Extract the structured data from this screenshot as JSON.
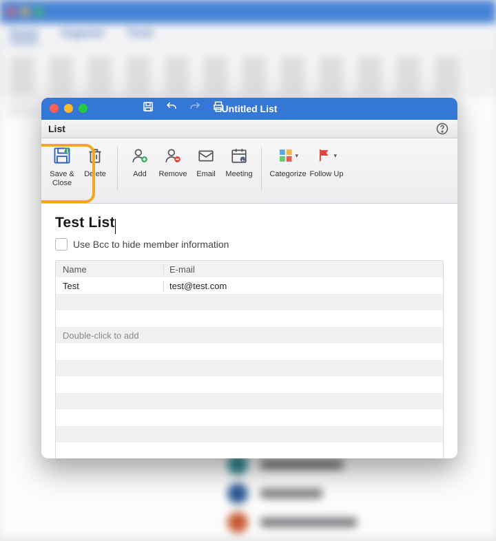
{
  "bg": {
    "tabs": [
      "Home",
      "Organize",
      "Tools"
    ]
  },
  "window": {
    "title": "Untitled List",
    "tab_label": "List"
  },
  "ribbon": {
    "save_close": "Save & Close",
    "delete": "Delete",
    "add": "Add",
    "remove": "Remove",
    "email": "Email",
    "meeting": "Meeting",
    "categorize": "Categorize",
    "follow_up": "Follow Up"
  },
  "list": {
    "name": "Test List",
    "bcc_label": "Use Bcc to hide member information",
    "headers": {
      "name": "Name",
      "email": "E-mail"
    },
    "rows": [
      {
        "name": "Test",
        "email": "test@test.com"
      }
    ],
    "add_placeholder": "Double-click to add"
  }
}
